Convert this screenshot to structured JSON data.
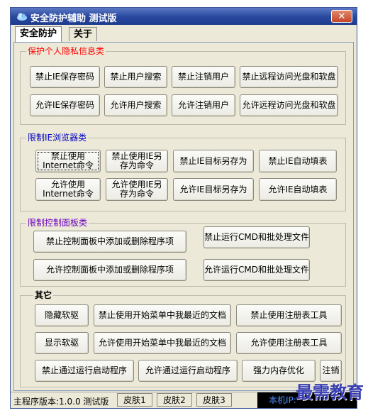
{
  "window": {
    "title": "安全防护辅助 测试版",
    "close_label": "✕"
  },
  "tabs": [
    {
      "label": "安全防护"
    },
    {
      "label": "关于"
    }
  ],
  "groups": {
    "privacy": {
      "title": "保护个人隐私信息类",
      "title_color": "#ff0000",
      "buttons": [
        "禁止IE保存密码",
        "禁止用户搜索",
        "禁止注销用户",
        "禁止远程访问光盘和软盘",
        "允许IE保存密码",
        "允许用户搜索",
        "允许注销用户",
        "允许远程访问光盘和软盘"
      ]
    },
    "ie": {
      "title": "限制IE浏览器类",
      "title_color": "#0000c0",
      "buttons": [
        {
          "line1": "禁止使用",
          "line2": "Internet命令"
        },
        {
          "line1": "禁止使用IE另",
          "line2": "存为命令"
        },
        {
          "line1": "禁止IE目标另存为",
          "line2": ""
        },
        {
          "line1": "禁止IE自动填表",
          "line2": ""
        },
        {
          "line1": "允许使用",
          "line2": "Internet命令"
        },
        {
          "line1": "允许使用IE另",
          "line2": "存为命令"
        },
        {
          "line1": "允许IE目标另存为",
          "line2": ""
        },
        {
          "line1": "允许IE自动填表",
          "line2": ""
        }
      ]
    },
    "control": {
      "title": "限制控制面板类",
      "title_color": "#6a00c0",
      "buttons": [
        "禁止控制面板中添加或删除程序项",
        "禁止运行CMD和批处理文件",
        "允许控制面板中添加或删除程序项",
        "允许运行CMD和批处理文件"
      ]
    },
    "other": {
      "title": "其它",
      "title_color": "#000000",
      "buttons": [
        "隐藏软驱",
        "禁止使用开始菜单中我最近的文档",
        "禁止使用注册表工具",
        "显示软驱",
        "允许使用开始菜单中我最近的文档",
        "允许使用注册表工具",
        "禁止通过运行启动程序",
        "允许通过运行启动程序",
        "强力内存优化",
        "注销"
      ]
    }
  },
  "statusbar": {
    "version": "主程序版本:1.0.0 测试版",
    "skins": [
      "皮肤1",
      "皮肤2",
      "皮肤3"
    ],
    "ip_label": "本机IP:"
  },
  "watermark": "最需教育",
  "colors": {
    "titlebar": "#2a4aa0",
    "ip_text": "#4a90ff"
  }
}
